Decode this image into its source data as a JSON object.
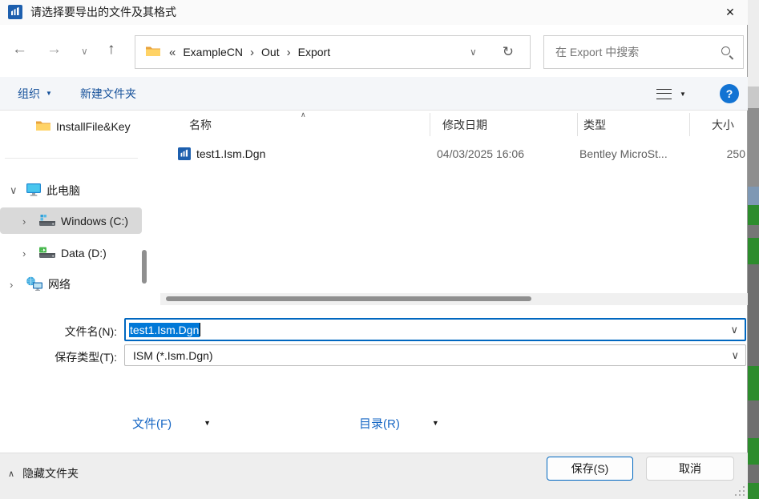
{
  "window": {
    "title": "请选择要导出的文件及其格式"
  },
  "nav": {
    "breadcrumb": [
      "ExampleCN",
      "Out",
      "Export"
    ],
    "search_placeholder": "在 Export 中搜索"
  },
  "toolbar": {
    "organize": "组织",
    "new_folder": "新建文件夹"
  },
  "sidebar": {
    "items": [
      {
        "label": "InstallFile&Key"
      },
      {
        "label": "此电脑"
      },
      {
        "label": "Windows (C:)"
      },
      {
        "label": "Data (D:)"
      },
      {
        "label": "网络"
      }
    ]
  },
  "file_list": {
    "columns": [
      "名称",
      "修改日期",
      "类型",
      "大小"
    ],
    "rows": [
      {
        "name": "test1.Ism.Dgn",
        "date": "04/03/2025 16:06",
        "type": "Bentley MicroSt...",
        "size": "250"
      }
    ]
  },
  "fields": {
    "filename_label": "文件名(N):",
    "filename_value": "test1.Ism.Dgn",
    "savetype_label": "保存类型(T):",
    "savetype_value": "ISM (*.Ism.Dgn)"
  },
  "actions": {
    "file_menu": "文件(F)",
    "dir_menu": "目录(R)"
  },
  "footer": {
    "hide_folders": "隐藏文件夹",
    "save": "保存(S)",
    "cancel": "取消"
  },
  "icons": {
    "back": "←",
    "forward": "→",
    "up": "↑",
    "history_chevron": "∨",
    "address_chevron": "∨",
    "refresh": "↻",
    "close": "✕",
    "caret_down": "▼",
    "breadcrumb_prefix": "«",
    "breadcrumb_sep": "›",
    "tree_expanded": "∨",
    "tree_collapsed": "›",
    "sort_asc": "∧",
    "combo_chevron": "∨",
    "help": "?",
    "hide_chevron": "∧"
  },
  "colors": {
    "accent_border": "#0067c0",
    "selection": "#0078d7",
    "toolbar_link": "#17529b",
    "action_link": "#1767c4"
  }
}
